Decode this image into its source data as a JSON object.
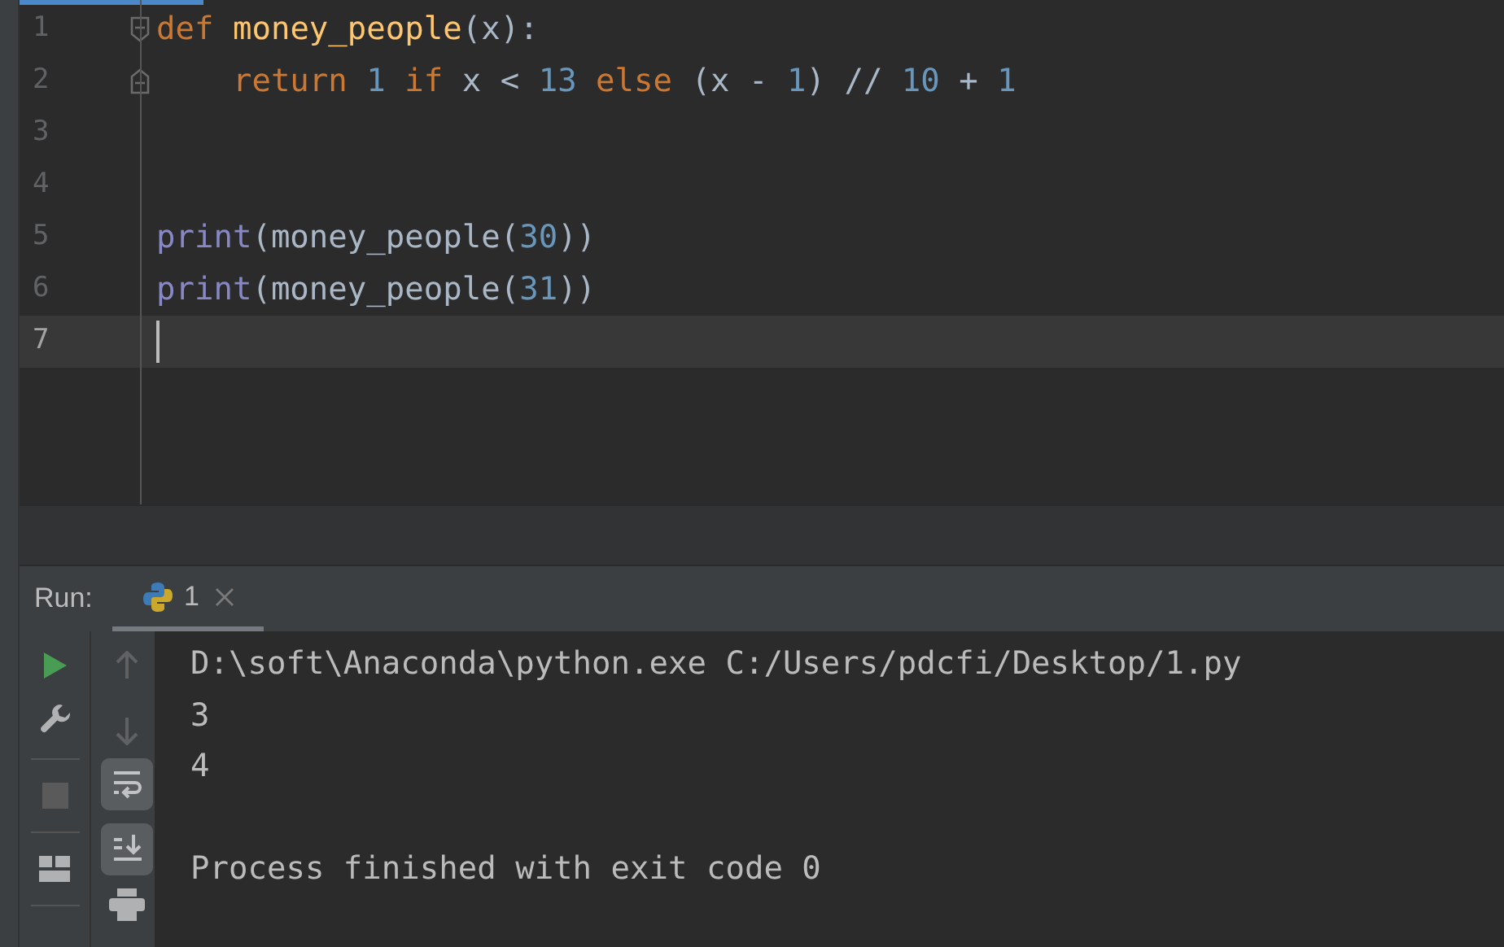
{
  "editor": {
    "lines": [
      {
        "number": "1",
        "current": false,
        "fold_open": true,
        "fold_close": false,
        "tokens": [
          {
            "text": "def",
            "kind": "keyword"
          },
          {
            "text": " money_people",
            "kind": "function"
          },
          {
            "text": "(x):",
            "kind": "plain"
          }
        ]
      },
      {
        "number": "2",
        "current": false,
        "fold_open": false,
        "fold_close": true,
        "tokens": [
          {
            "text": "    return",
            "kind": "keyword"
          },
          {
            "text": " 1",
            "kind": "number"
          },
          {
            "text": " if",
            "kind": "keyword"
          },
          {
            "text": " x < ",
            "kind": "plain"
          },
          {
            "text": "13",
            "kind": "number"
          },
          {
            "text": " else",
            "kind": "keyword"
          },
          {
            "text": " (x - ",
            "kind": "plain"
          },
          {
            "text": "1",
            "kind": "number"
          },
          {
            "text": ") // ",
            "kind": "plain"
          },
          {
            "text": "10",
            "kind": "number"
          },
          {
            "text": " + ",
            "kind": "plain"
          },
          {
            "text": "1",
            "kind": "number"
          }
        ]
      },
      {
        "number": "3",
        "current": false,
        "fold_open": false,
        "fold_close": false
      },
      {
        "number": "4",
        "current": false,
        "fold_open": false,
        "fold_close": false
      },
      {
        "number": "5",
        "current": false,
        "fold_open": false,
        "fold_close": false,
        "tokens": [
          {
            "text": "print",
            "kind": "builtin"
          },
          {
            "text": "(money_people(",
            "kind": "plain"
          },
          {
            "text": "30",
            "kind": "number"
          },
          {
            "text": "))",
            "kind": "plain"
          }
        ]
      },
      {
        "number": "6",
        "current": false,
        "fold_open": false,
        "fold_close": false,
        "tokens": [
          {
            "text": "print",
            "kind": "builtin"
          },
          {
            "text": "(money_people(",
            "kind": "plain"
          },
          {
            "text": "31",
            "kind": "number"
          },
          {
            "text": "))",
            "kind": "plain"
          }
        ]
      },
      {
        "number": "7",
        "current": true,
        "fold_open": false,
        "fold_close": false
      }
    ]
  },
  "run_panel": {
    "label": "Run:",
    "tabs": [
      {
        "label": "1",
        "selected": true
      }
    ],
    "console_blocks": [
      [
        "D:\\soft\\Anaconda\\python.exe C:/Users/pdcfi/Desktop/1.py",
        "3",
        "4"
      ],
      [
        "Process finished with exit code 0"
      ]
    ]
  }
}
